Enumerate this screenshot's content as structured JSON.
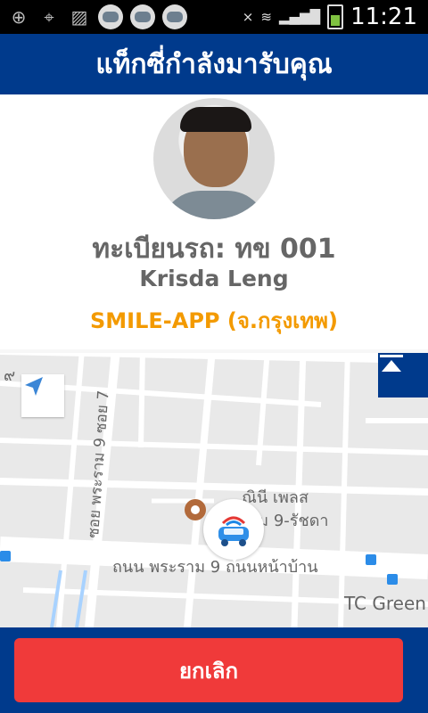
{
  "status_bar": {
    "time": "11:21",
    "icons": [
      "plus-icon",
      "crosshair-icon",
      "image-icon",
      "taxi-icon",
      "taxi-icon",
      "taxi-icon",
      "mute-icon",
      "wifi-icon",
      "signal-icon",
      "battery-icon"
    ]
  },
  "header": {
    "title": "แท็กซี่กำลังมารับคุณ"
  },
  "driver": {
    "plate": "ทะเบียนรถ: ทข 001",
    "name": "Krisda Leng",
    "company": "SMILE-APP (จ.กรุงเทพ)"
  },
  "map": {
    "labels": {
      "top_left": "๙",
      "road_vertical": "ซอย พระราม 9 ซอย 7",
      "place_1": "...ณินี เพลส",
      "place_2": "...าม 9-รัชดา",
      "road_main": "ถนน พระราม 9 ถนนหน้าบ้าน",
      "place_3": "TC Green"
    },
    "icons": [
      "navigation-arrow-icon",
      "collapse-up-icon",
      "taxi-marker-icon",
      "map-pin-icon",
      "bus-stop-icon"
    ]
  },
  "footer": {
    "cancel_label": "ยกเลิก"
  }
}
